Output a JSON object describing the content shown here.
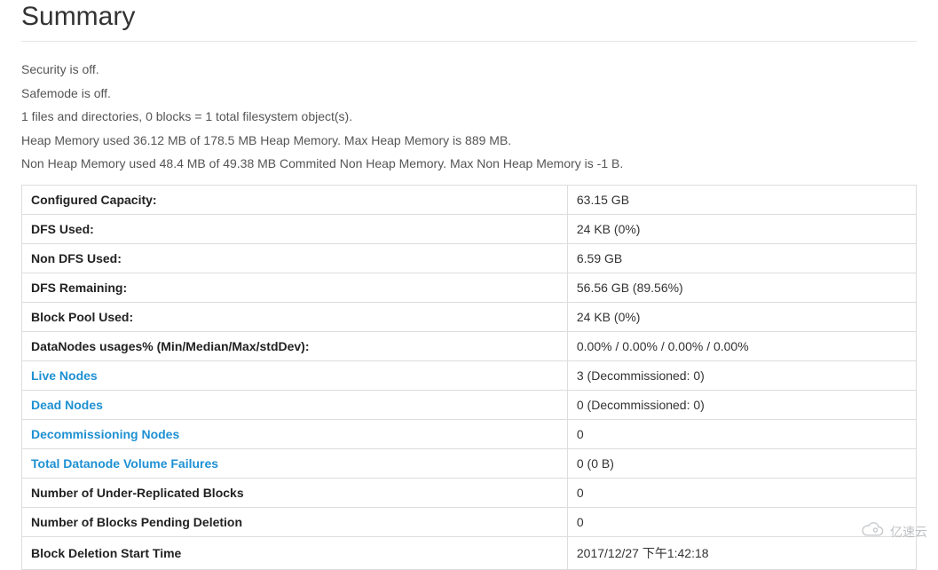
{
  "header": {
    "title": "Summary"
  },
  "info": {
    "security": "Security is off.",
    "safemode": "Safemode is off.",
    "filesystem": "1 files and directories, 0 blocks = 1 total filesystem object(s).",
    "heap": "Heap Memory used 36.12 MB of 178.5 MB Heap Memory. Max Heap Memory is 889 MB.",
    "nonheap": "Non Heap Memory used 48.4 MB of 49.38 MB Commited Non Heap Memory. Max Non Heap Memory is -1 B."
  },
  "table": {
    "rows": [
      {
        "label": "Configured Capacity:",
        "value": "63.15 GB",
        "link": false
      },
      {
        "label": "DFS Used:",
        "value": "24 KB (0%)",
        "link": false
      },
      {
        "label": "Non DFS Used:",
        "value": "6.59 GB",
        "link": false
      },
      {
        "label": "DFS Remaining:",
        "value": "56.56 GB (89.56%)",
        "link": false
      },
      {
        "label": "Block Pool Used:",
        "value": "24 KB (0%)",
        "link": false
      },
      {
        "label": "DataNodes usages% (Min/Median/Max/stdDev):",
        "value": "0.00% / 0.00% / 0.00% / 0.00%",
        "link": false
      },
      {
        "label": "Live Nodes",
        "value": "3 (Decommissioned: 0)",
        "link": true
      },
      {
        "label": "Dead Nodes",
        "value": "0 (Decommissioned: 0)",
        "link": true
      },
      {
        "label": "Decommissioning Nodes",
        "value": "0",
        "link": true
      },
      {
        "label": "Total Datanode Volume Failures",
        "value": "0 (0 B)",
        "link": true
      },
      {
        "label": "Number of Under-Replicated Blocks",
        "value": "0",
        "link": false
      },
      {
        "label": "Number of Blocks Pending Deletion",
        "value": "0",
        "link": false
      },
      {
        "label": "Block Deletion Start Time",
        "value": "2017/12/27 下午1:42:18",
        "link": false
      }
    ]
  },
  "watermark": {
    "text": "亿速云"
  }
}
